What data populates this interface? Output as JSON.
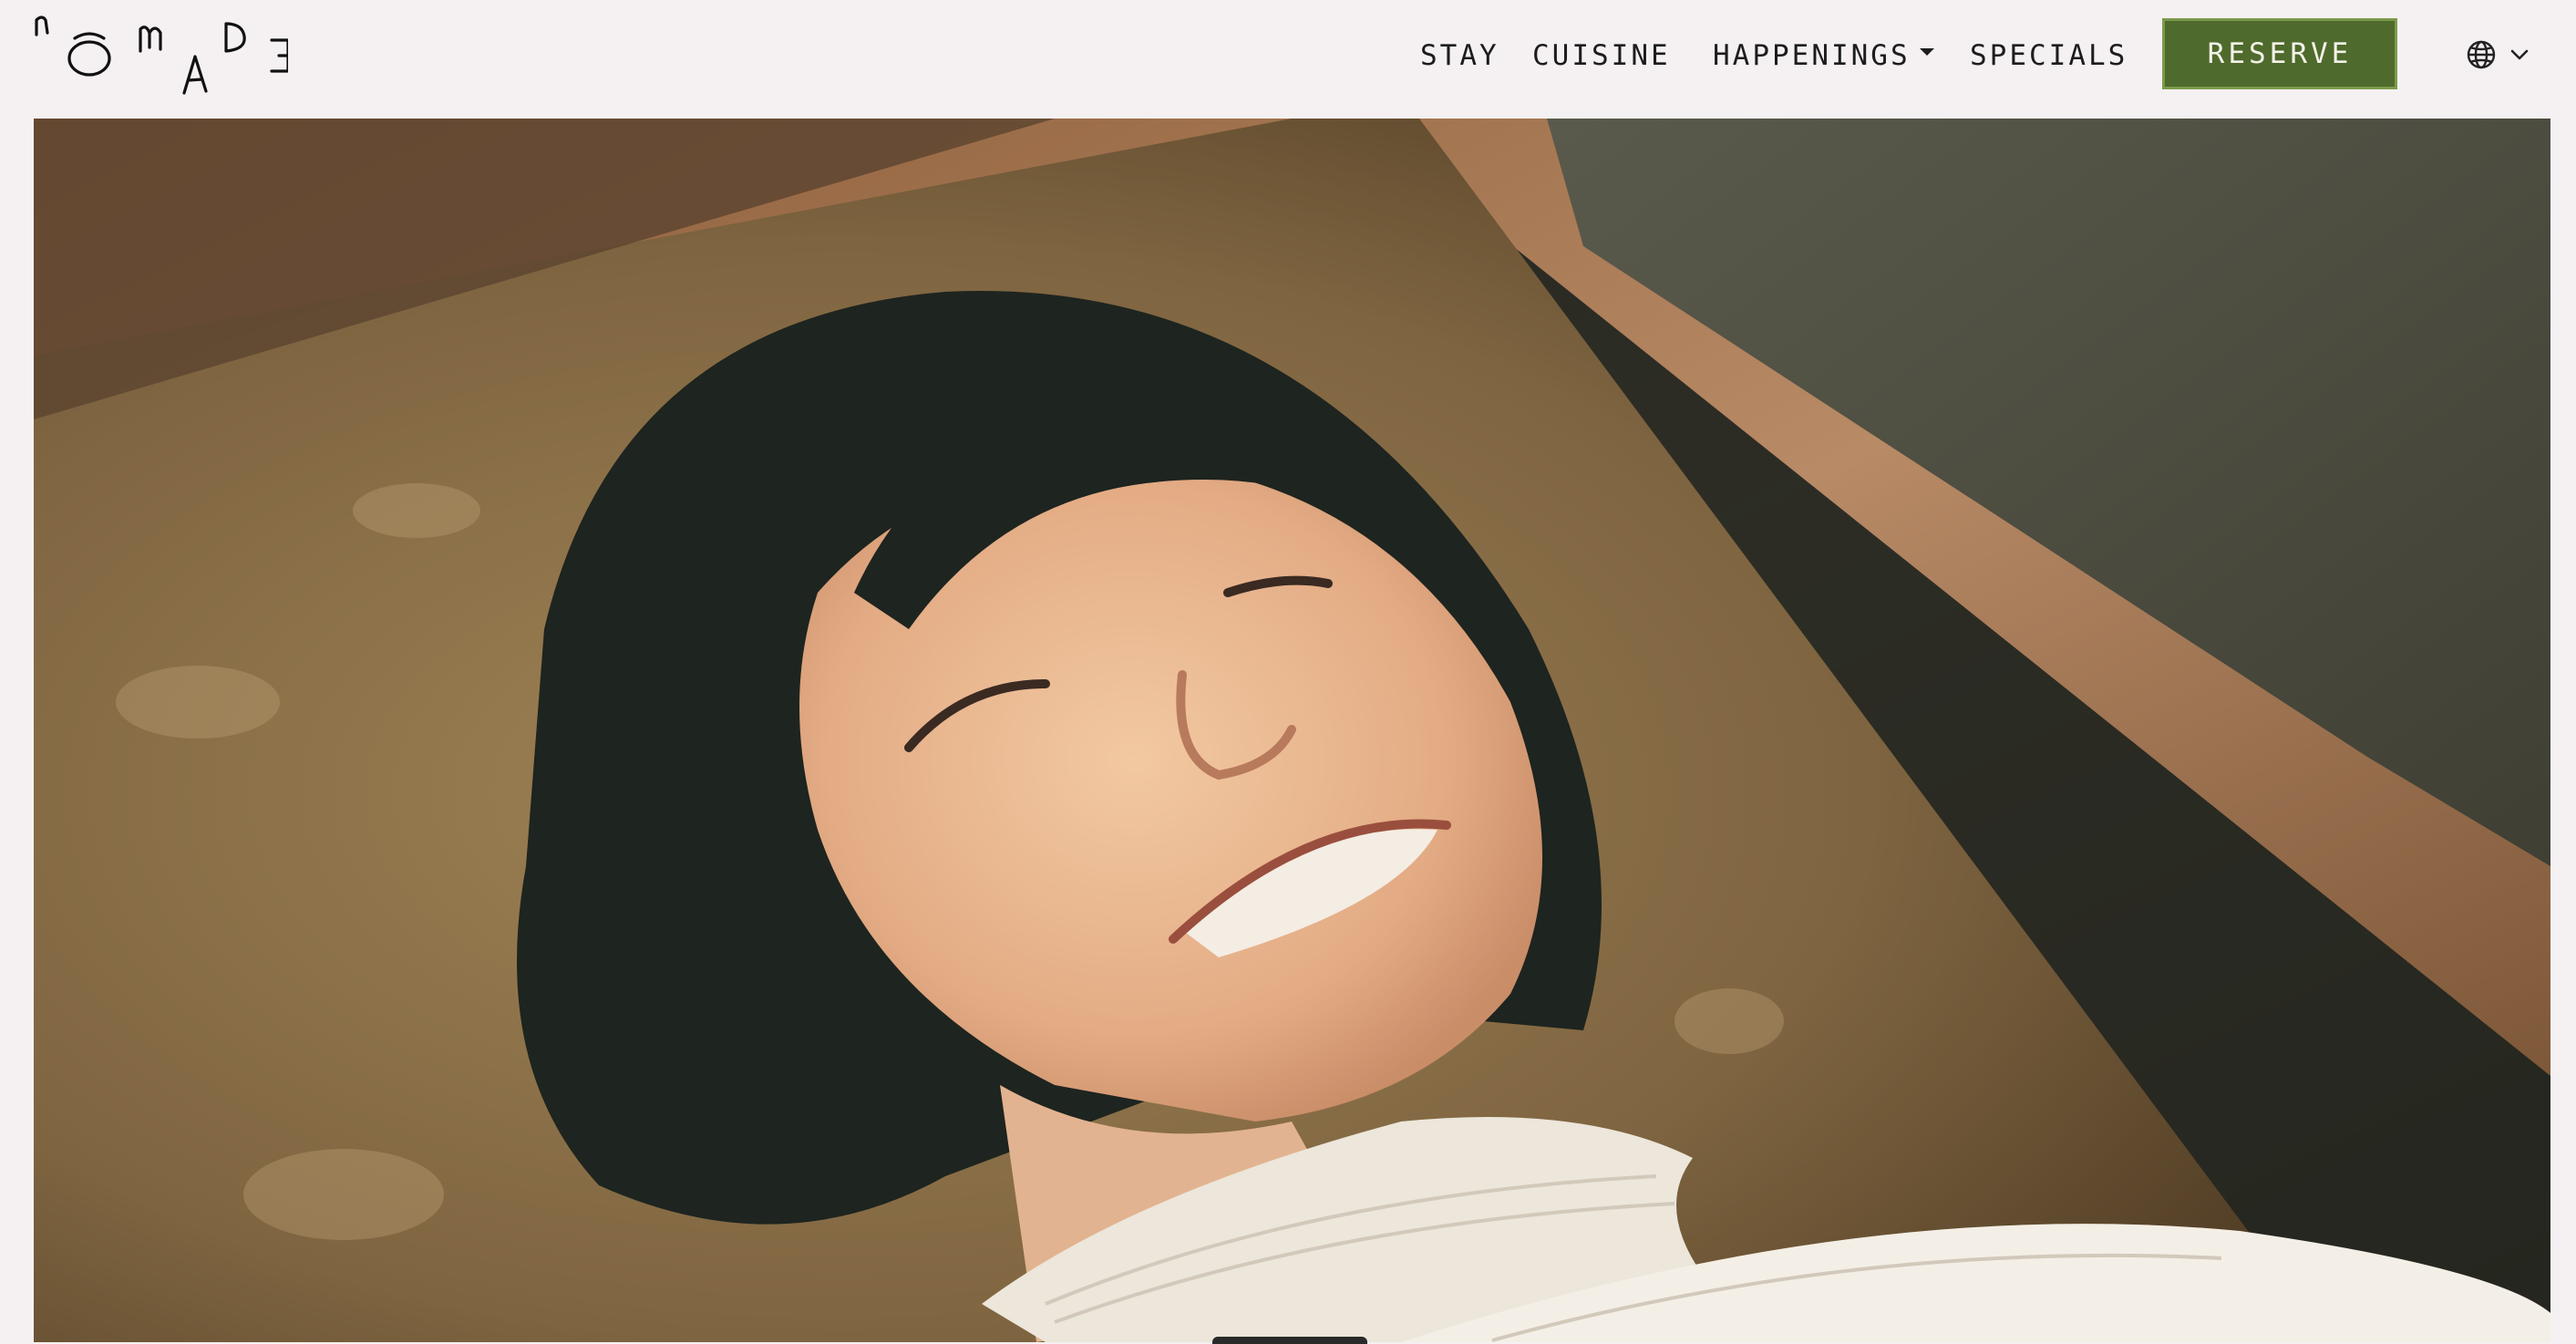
{
  "brand": {
    "name": "NŌMADE"
  },
  "nav": {
    "items": [
      {
        "label": "STAY"
      },
      {
        "label": "CUISINE"
      },
      {
        "label": "HAPPENINGS",
        "has_dropdown": true
      },
      {
        "label": "SPECIALS"
      }
    ],
    "reserve_label": "RESERVE",
    "language_icon": "globe-icon",
    "language_caret_icon": "chevron-down-icon"
  },
  "colors": {
    "background": "#f5f1f2",
    "reserve_button": "#4e6a2c",
    "text": "#1d1d1d"
  },
  "hero": {
    "description": "Photo of a smiling woman with short dark hair lying on a woven cushion"
  }
}
